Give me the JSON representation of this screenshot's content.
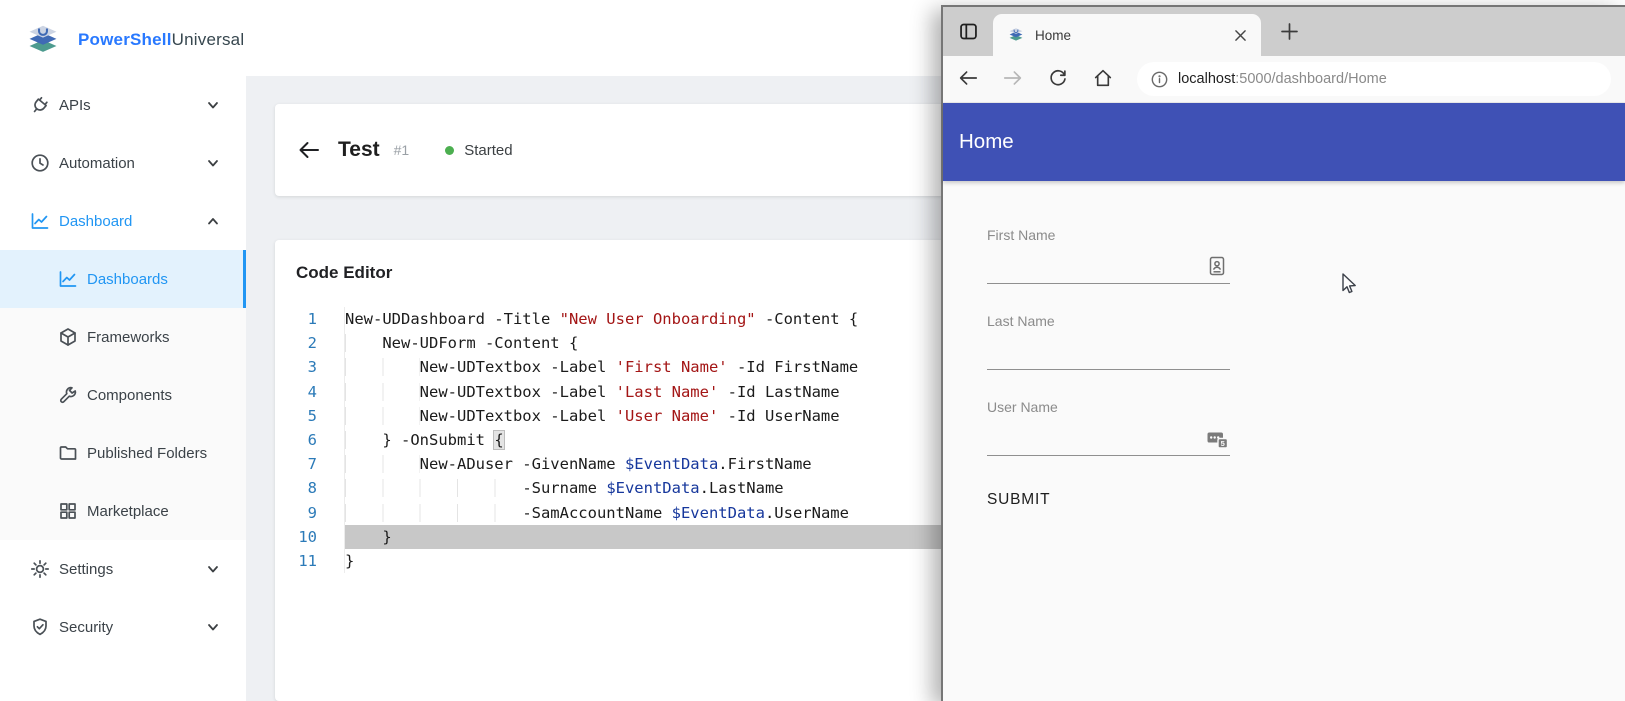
{
  "colors": {
    "accent": "#2196f3",
    "accent2": "#2979ff",
    "appbar": "#3f51b5",
    "green": "#4caf50",
    "string": "#a31515",
    "variable": "#16379c",
    "lineno": "#2b7ab8"
  },
  "admin": {
    "brand": {
      "bold": "PowerShell",
      "light": "Universal"
    },
    "sidebar": {
      "items": [
        {
          "label": "APIs",
          "icon": "plug-icon",
          "chevron": "down"
        },
        {
          "label": "Automation",
          "icon": "clock-icon",
          "chevron": "down"
        },
        {
          "label": "Dashboard",
          "icon": "chart-icon",
          "chevron": "up",
          "active": true
        },
        {
          "label": "Dashboards",
          "icon": "chart-icon",
          "sub": true,
          "selected": true
        },
        {
          "label": "Frameworks",
          "icon": "cube-icon",
          "sub": true
        },
        {
          "label": "Components",
          "icon": "wrench-icon",
          "sub": true
        },
        {
          "label": "Published Folders",
          "icon": "folder-icon",
          "sub": true
        },
        {
          "label": "Marketplace",
          "icon": "grid-icon",
          "sub": true
        },
        {
          "label": "Settings",
          "icon": "gear-icon",
          "chevron": "down"
        },
        {
          "label": "Security",
          "icon": "shield-icon",
          "chevron": "down"
        }
      ]
    },
    "page": {
      "title": "Test",
      "number": "#1",
      "status": "Started"
    },
    "editor": {
      "title": "Code Editor",
      "highlight_line": 10,
      "lines": [
        {
          "n": 1,
          "segs": [
            [
              "p",
              "New-UDDashboard -Title "
            ],
            [
              "s",
              "\"New User Onboarding\""
            ],
            [
              "p",
              " -Content {"
            ]
          ]
        },
        {
          "n": 2,
          "segs": [
            [
              "p",
              "    New-UDForm -Content {"
            ]
          ]
        },
        {
          "n": 3,
          "segs": [
            [
              "p",
              "        New-UDTextbox -Label "
            ],
            [
              "s",
              "'First Name'"
            ],
            [
              "p",
              " -Id FirstName"
            ]
          ]
        },
        {
          "n": 4,
          "segs": [
            [
              "p",
              "        New-UDTextbox -Label "
            ],
            [
              "s",
              "'Last Name'"
            ],
            [
              "p",
              " -Id LastName"
            ]
          ]
        },
        {
          "n": 5,
          "segs": [
            [
              "p",
              "        New-UDTextbox -Label "
            ],
            [
              "s",
              "'User Name'"
            ],
            [
              "p",
              " -Id UserName"
            ]
          ]
        },
        {
          "n": 6,
          "segs": [
            [
              "p",
              "    } -OnSubmit "
            ],
            [
              "b",
              "{"
            ]
          ]
        },
        {
          "n": 7,
          "segs": [
            [
              "p",
              "        New-ADuser -GivenName "
            ],
            [
              "v",
              "$EventData"
            ],
            [
              "p",
              ".FirstName"
            ]
          ]
        },
        {
          "n": 8,
          "segs": [
            [
              "p",
              "                   -Surname "
            ],
            [
              "v",
              "$EventData"
            ],
            [
              "p",
              ".LastName"
            ]
          ]
        },
        {
          "n": 9,
          "segs": [
            [
              "p",
              "                   -SamAccountName "
            ],
            [
              "v",
              "$EventData"
            ],
            [
              "p",
              ".UserName"
            ]
          ]
        },
        {
          "n": 10,
          "segs": [
            [
              "p",
              "    }"
            ]
          ]
        },
        {
          "n": 11,
          "segs": [
            [
              "p",
              "}"
            ]
          ]
        }
      ]
    }
  },
  "browser": {
    "tab": {
      "title": "Home"
    },
    "url": {
      "host": "localhost",
      "path": ":5000/dashboard/Home"
    },
    "page": {
      "title": "Home",
      "fields": [
        {
          "label": "First Name",
          "icon": "contact-autofill-icon"
        },
        {
          "label": "Last Name"
        },
        {
          "label": "User Name",
          "icon": "password-autofill-icon"
        }
      ],
      "submit_label": "SUBMIT"
    }
  }
}
